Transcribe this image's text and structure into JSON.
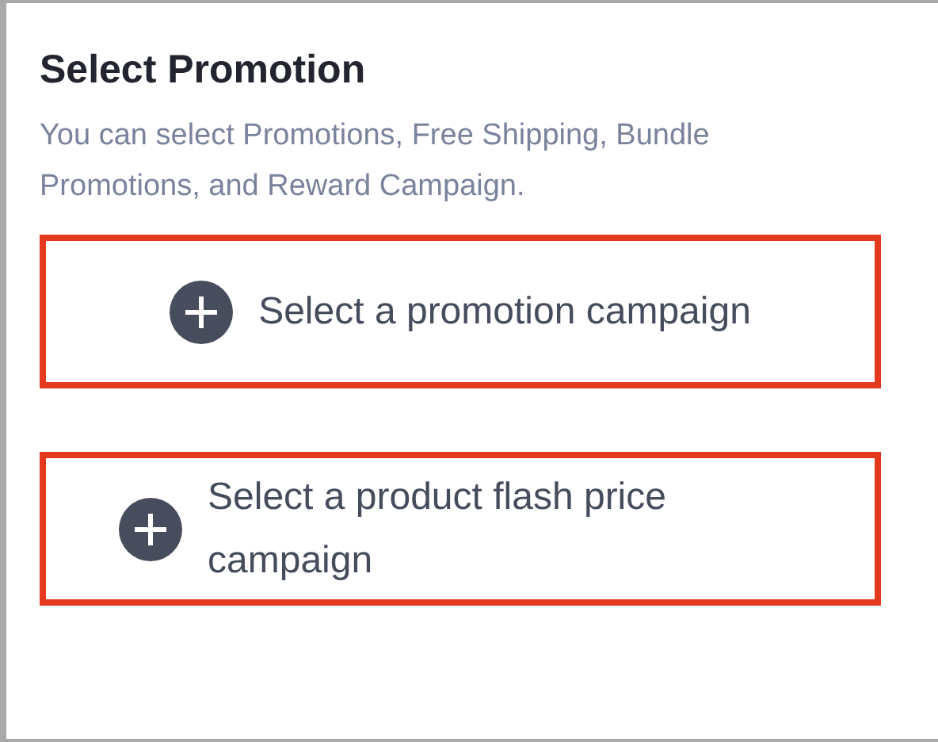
{
  "title": "Select Promotion",
  "description": "You can select Promotions, Free Shipping, Bundle Promotions, and Reward Campaign.",
  "options": [
    {
      "label": "Select a promotion campaign",
      "highlighted": true
    },
    {
      "label": "Select a product flash price campaign",
      "highlighted": true
    }
  ]
}
